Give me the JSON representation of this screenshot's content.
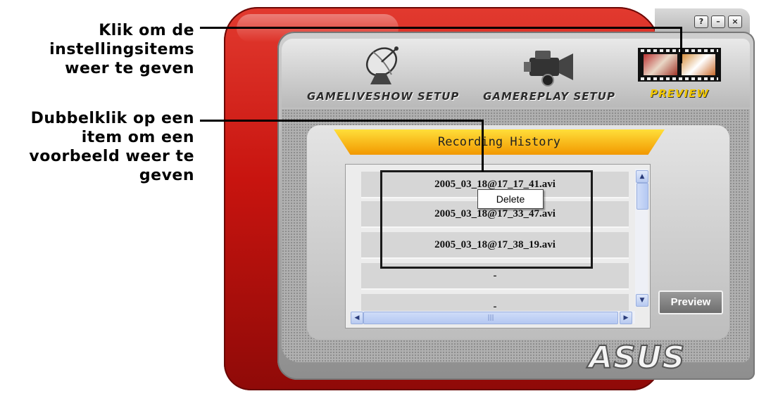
{
  "callouts": {
    "settings_text": "Klik om de instellingsitems weer te geven",
    "doubleclick_text": "Dubbelklik op een item om een voorbeeld weer te geven"
  },
  "window_controls": {
    "help": "?",
    "minimize": "–",
    "close": "×"
  },
  "toolbar": {
    "liveshow_label": "GAMELIVESHOW SETUP",
    "replay_label": "GAMEREPLAY SETUP",
    "preview_label": "PREVIEW"
  },
  "history": {
    "title": "Recording History",
    "items": [
      "2005_03_18@17_17_41.avi",
      "2005_03_18@17_33_47.avi",
      "2005_03_18@17_38_19.avi",
      "-",
      "-"
    ]
  },
  "context_menu": {
    "delete_label": "Delete"
  },
  "preview_button_label": "Preview",
  "logo_text": "ASUS",
  "icons": [
    "satellite-dish-icon",
    "video-camera-icon",
    "film-strip-icon"
  ],
  "colors": {
    "frame_red": "#d4231a",
    "banner_yellow": "#f8c21c",
    "preview_label": "#f0c600"
  }
}
